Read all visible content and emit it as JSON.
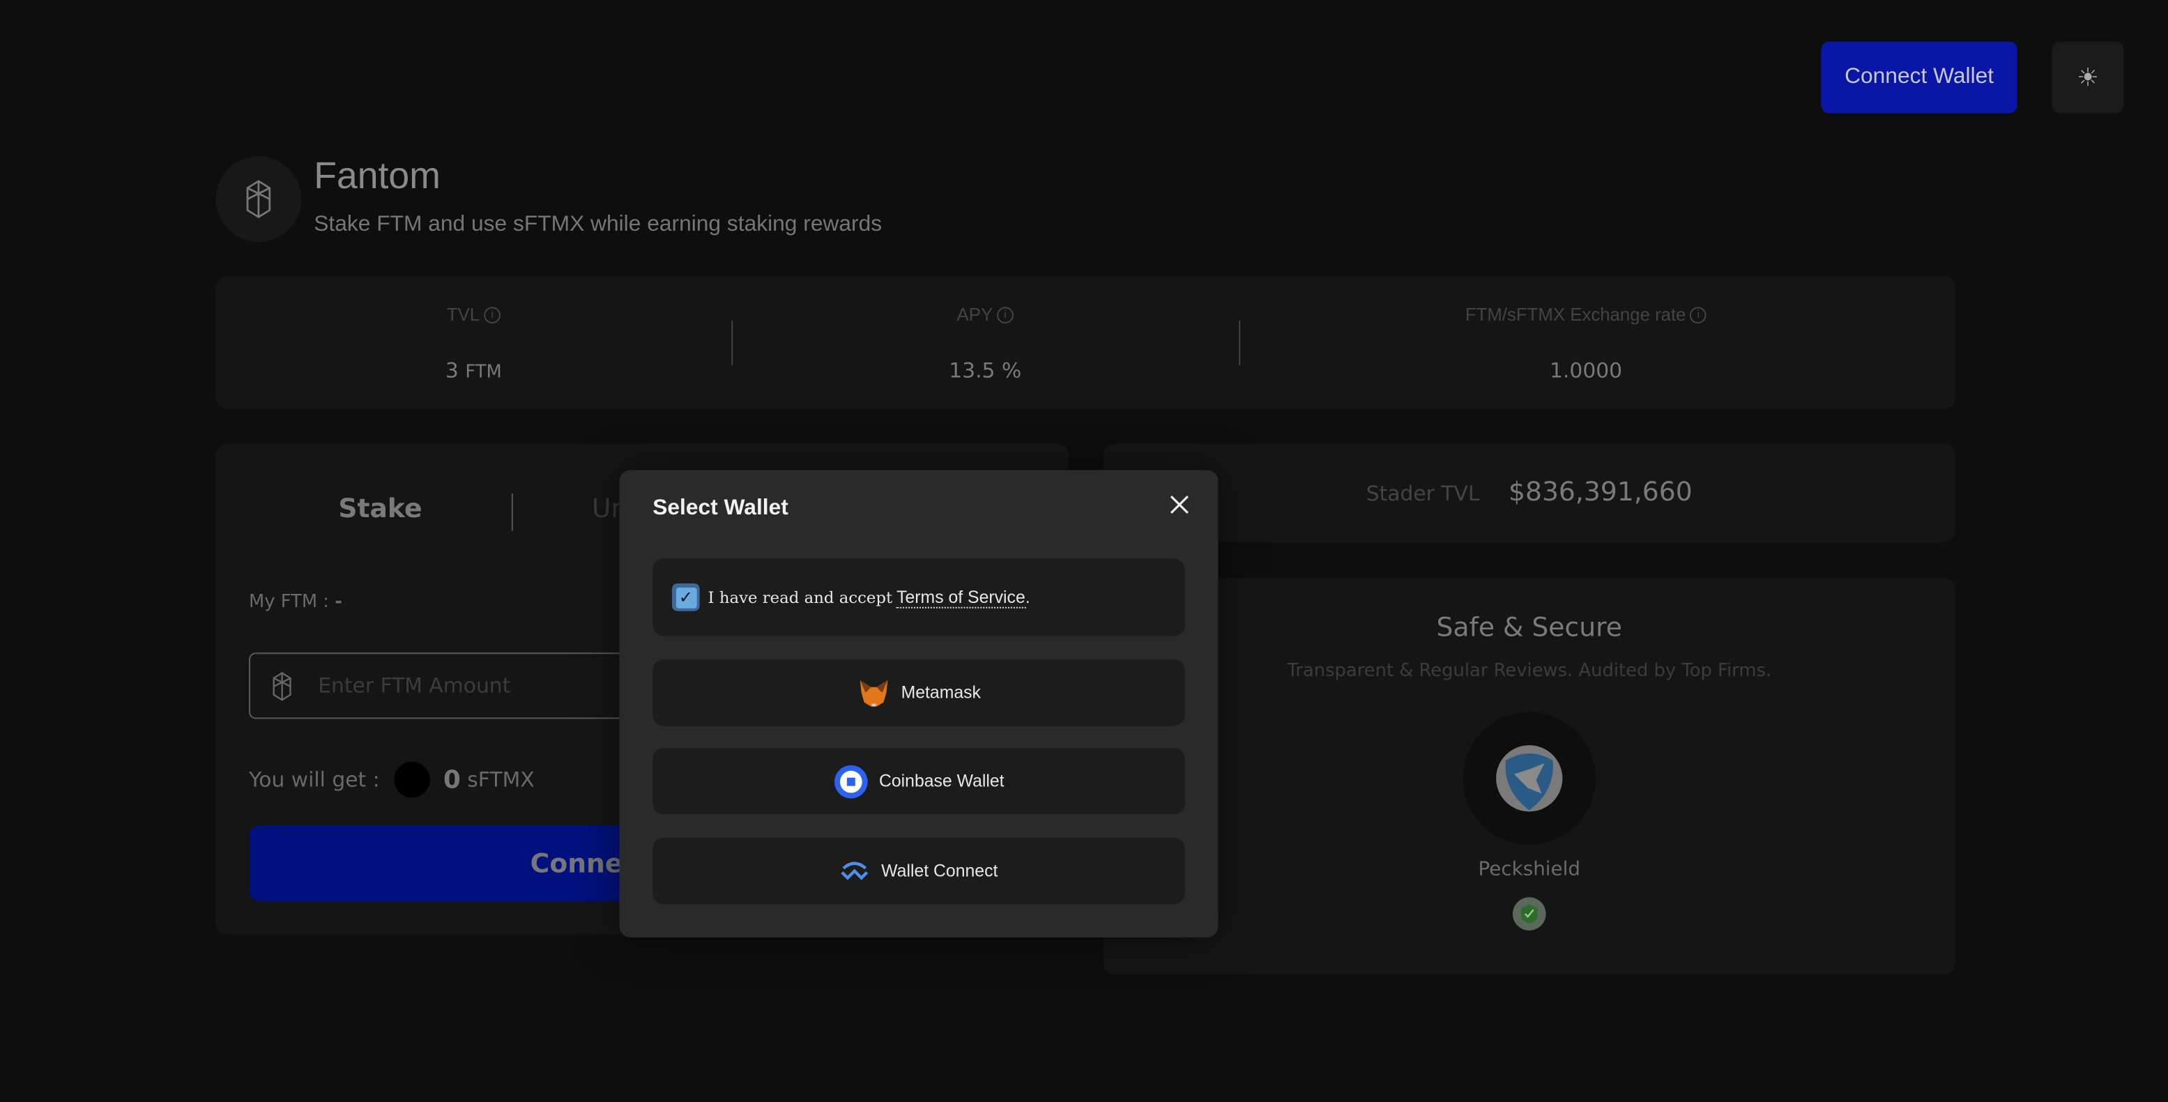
{
  "header": {
    "connect_wallet_label": "Connect Wallet",
    "theme_icon": "sun-icon"
  },
  "network": {
    "title": "Fantom",
    "subtitle": "Stake FTM and use sFTMX while earning staking rewards",
    "logo_icon": "fantom-logo-icon"
  },
  "stats": [
    {
      "label": "TVL",
      "value": "3",
      "unit": "FTM"
    },
    {
      "label": "APY",
      "value": "13.5 %"
    },
    {
      "label": "FTM/sFTMX Exchange rate",
      "value": "1.0000"
    }
  ],
  "stake_panel": {
    "tabs": [
      {
        "label": "Stake",
        "active": true
      },
      {
        "label": "Unstake",
        "active": false
      }
    ],
    "balance_label": "My FTM :",
    "balance_value": "-",
    "amount_placeholder": "Enter FTM Amount",
    "receive_label": "You will get :",
    "receive_value": "0",
    "receive_unit": "sFTMX",
    "submit_label": "Connect Wallet"
  },
  "stader_tvl": {
    "label": "Stader TVL",
    "value": "$836,391,660"
  },
  "security": {
    "title": "Safe & Secure",
    "subtitle": "Transparent & Regular Reviews. Audited by Top Firms.",
    "auditor": "Peckshield"
  },
  "modal": {
    "title": "Select Wallet",
    "terms_checked": true,
    "terms_prefix": "I have read and accept ",
    "terms_link": "Terms of Service",
    "terms_suffix": ".",
    "wallets": [
      {
        "label": "Metamask",
        "icon": "metamask-fox-icon"
      },
      {
        "label": "Coinbase Wallet",
        "icon": "coinbase-icon"
      },
      {
        "label": "Wallet Connect",
        "icon": "walletconnect-icon"
      }
    ]
  },
  "colors": {
    "accent": "#0a16a6",
    "background": "#0e0e0e",
    "modal": "#2a2a2a"
  }
}
